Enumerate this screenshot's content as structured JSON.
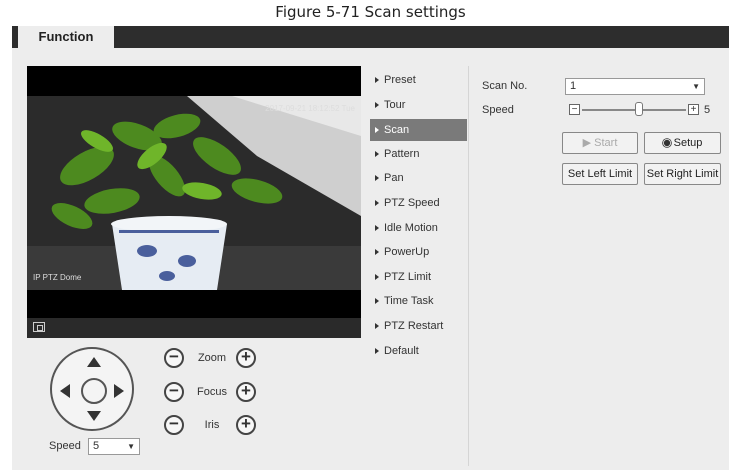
{
  "caption": "Figure 5-71 Scan settings",
  "tab": {
    "label": "Function"
  },
  "video": {
    "timestamp": "2017-09-21 18:12:52 Tue",
    "camera_name": "IP PTZ Dome"
  },
  "ptz_controls": {
    "zoom_label": "Zoom",
    "focus_label": "Focus",
    "iris_label": "Iris",
    "minus": "−",
    "plus": "+",
    "speed_label": "Speed",
    "speed_value": "5"
  },
  "menu": {
    "items": [
      {
        "label": "Preset"
      },
      {
        "label": "Tour"
      },
      {
        "label": "Scan"
      },
      {
        "label": "Pattern"
      },
      {
        "label": "Pan"
      },
      {
        "label": "PTZ Speed"
      },
      {
        "label": "Idle Motion"
      },
      {
        "label": "PowerUp"
      },
      {
        "label": "PTZ Limit"
      },
      {
        "label": "Time Task"
      },
      {
        "label": "PTZ Restart"
      },
      {
        "label": "Default"
      }
    ],
    "active": "Scan"
  },
  "scan": {
    "scan_no_label": "Scan No.",
    "scan_no_value": "1",
    "speed_label": "Speed",
    "speed_value": "5",
    "speed_minus": "−",
    "speed_plus": "+",
    "start_label": "Start",
    "setup_label": "Setup",
    "set_left_label": "Set Left Limit",
    "set_right_label": "Set Right Limit"
  }
}
